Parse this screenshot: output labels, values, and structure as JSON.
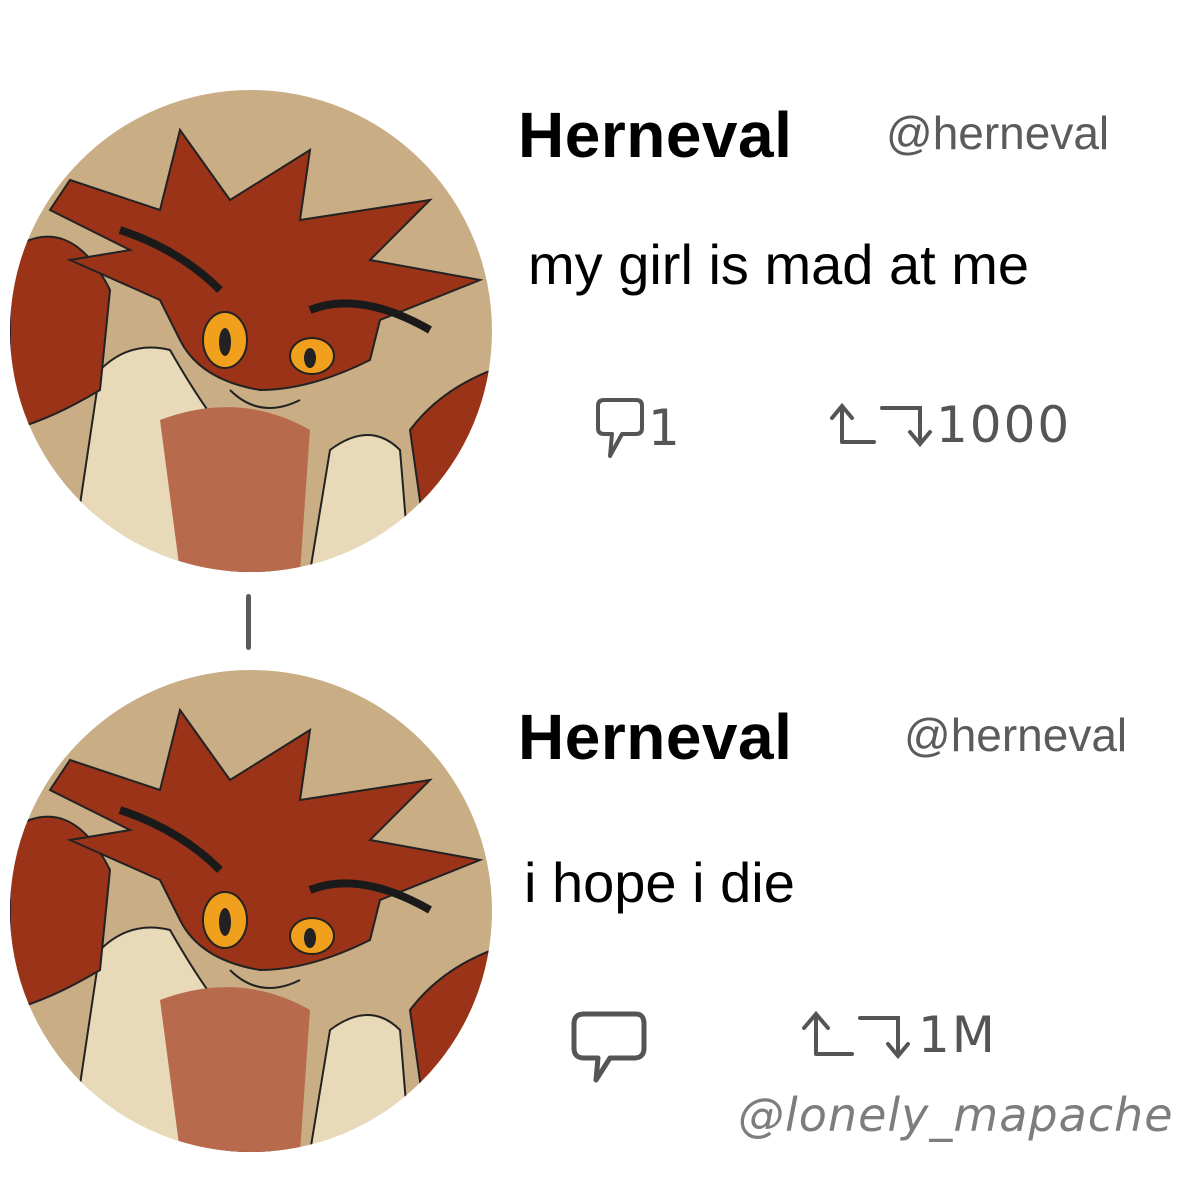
{
  "tweets": [
    {
      "name": "Herneval",
      "handle": "@herneval",
      "text": "my girl is mad at me",
      "replies": "1",
      "retweets": "1000"
    },
    {
      "name": "Herneval",
      "handle": "@herneval",
      "text": "i hope i die",
      "replies": "",
      "retweets": "1M"
    }
  ],
  "signature": "@lonely_mapache",
  "colors": {
    "avatar_background": "#c9ad85",
    "fur": "#9a3318",
    "eyes": "#f0a01c",
    "collar": "#e8d9b8",
    "icon_gray": "#555555"
  }
}
